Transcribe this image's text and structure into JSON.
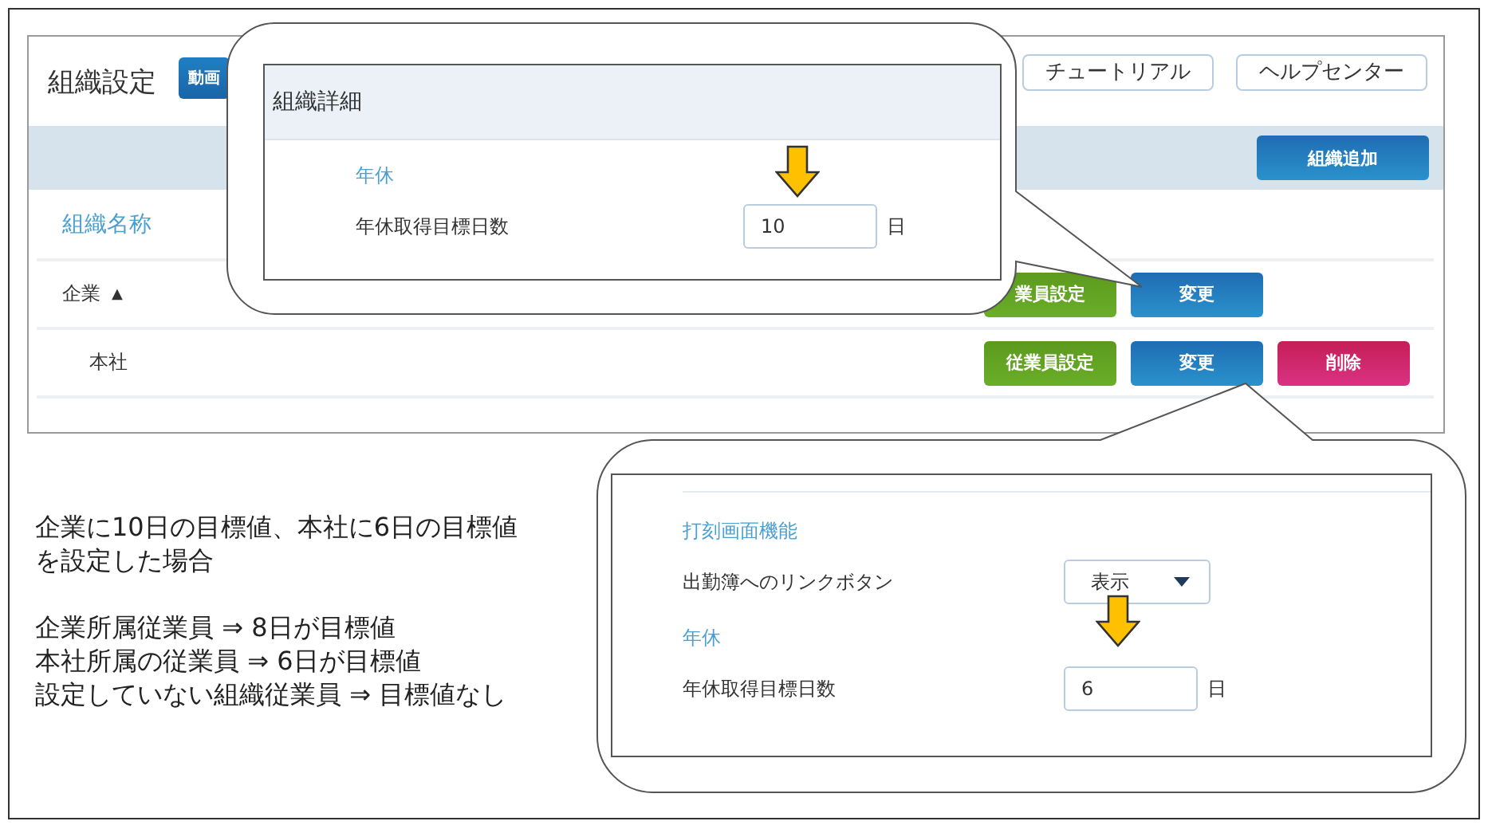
{
  "page_title": "組織設定",
  "video_button": "動画",
  "header_buttons": [
    "チュートリアル",
    "ヘルプセンター"
  ],
  "add_button": "組織追加",
  "table": {
    "column_header": "組織名称",
    "rows": [
      {
        "name": "企業",
        "marker": "▲",
        "actions": [
          {
            "kind": "employees",
            "label": "業員設定"
          },
          {
            "kind": "edit",
            "label": "変更"
          }
        ],
        "children": [
          {
            "name": "本社",
            "actions": [
              {
                "kind": "employees",
                "label": "従業員設定"
              },
              {
                "kind": "edit",
                "label": "変更"
              },
              {
                "kind": "delete",
                "label": "削除"
              }
            ]
          }
        ]
      }
    ]
  },
  "callouts": [
    {
      "title": "組織詳細",
      "items": [
        {
          "kind": "heading",
          "text": "年休"
        },
        {
          "kind": "number",
          "label": "年休取得目標日数",
          "value": "10",
          "unit": "日"
        }
      ]
    },
    {
      "items": [
        {
          "kind": "heading",
          "text": "打刻画面機能"
        },
        {
          "kind": "select",
          "label": "出勤簿へのリンクボタン",
          "value": "表示"
        },
        {
          "kind": "heading",
          "text": "年休"
        },
        {
          "kind": "number",
          "label": "年休取得目標日数",
          "value": "6",
          "unit": "日"
        }
      ]
    }
  ],
  "note": {
    "intro": "企業に10日の目標値、本社に6日の目標値を設定した場合",
    "results": [
      "企業所属従業員 ⇒ 8日が目標値",
      "本社所属の従業員 ⇒ 6日が目標値",
      "設定していない組織従業員 ⇒ 目標値なし"
    ]
  }
}
